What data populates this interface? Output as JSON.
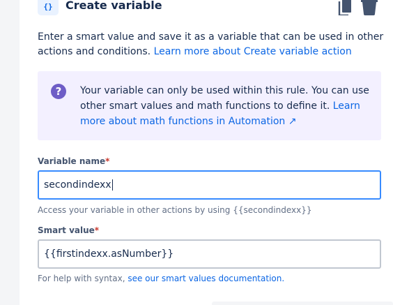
{
  "header": {
    "icon": "curly-braces-icon",
    "icon_glyph": "{}",
    "title": "Create variable"
  },
  "intro": {
    "text": "Enter a smart value and save it as a variable that can be used in other actions and conditions. ",
    "link": "Learn more about Create variable action"
  },
  "info": {
    "icon": "question-icon",
    "icon_glyph": "?",
    "text": "Your variable can only be used within this rule. You can use other smart values and math functions to define it. ",
    "link": "Learn more about math functions in Automation ↗"
  },
  "variable_name": {
    "label": "Variable name",
    "required_mark": "*",
    "value": "secondindexx",
    "helper": "Access your variable in other actions by using {{secondindexx}}"
  },
  "smart_value": {
    "label": "Smart value",
    "required_mark": "*",
    "value": "{{firstindexx.asNumber}}",
    "helper_text": "For help with syntax, ",
    "helper_link": "see our smart values documentation."
  },
  "colors": {
    "accent": "#0c66e4",
    "info_background": "#f3f0ff",
    "info_icon": "#6e5dc6",
    "focus_border": "#388bff",
    "required": "#c9372c"
  }
}
